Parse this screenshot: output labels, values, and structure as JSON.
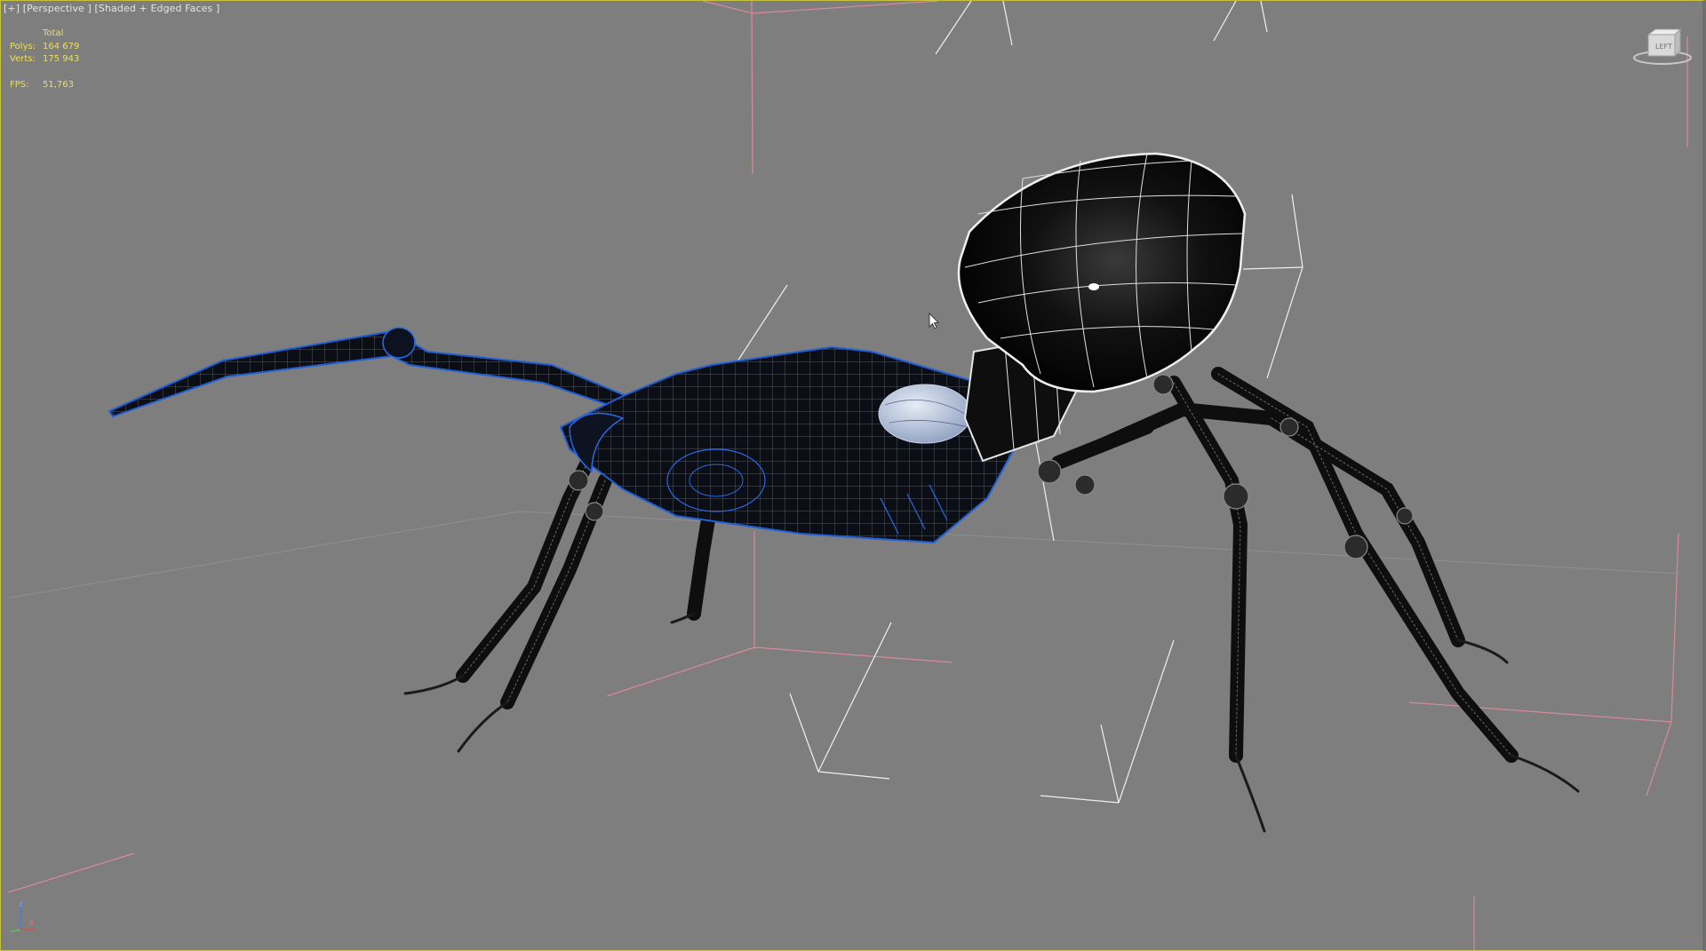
{
  "viewport": {
    "menu_plus": "[+]",
    "view_mode": "[Perspective ]",
    "shading_mode": "[Shaded + Edged Faces ]"
  },
  "stats": {
    "header": "Total",
    "polys_label": "Polys:",
    "polys_value": "164 679",
    "verts_label": "Verts:",
    "verts_value": "175 943",
    "fps_label": "FPS:",
    "fps_value": "51,763"
  },
  "colors": {
    "viewport_bg": "#7e7e7e",
    "stats_text": "#ece05a",
    "selection_wire": "#1f5fd8",
    "grid_pink": "#d88a9a",
    "helper_white": "#f0f0f0",
    "active_border": "#c6c23a"
  },
  "icons": {
    "viewcube": "viewcube-icon",
    "axis_triad": "axis-triad-icon",
    "cursor": "mouse-pointer-icon"
  },
  "axis_labels": {
    "z": "z",
    "x": "x"
  }
}
